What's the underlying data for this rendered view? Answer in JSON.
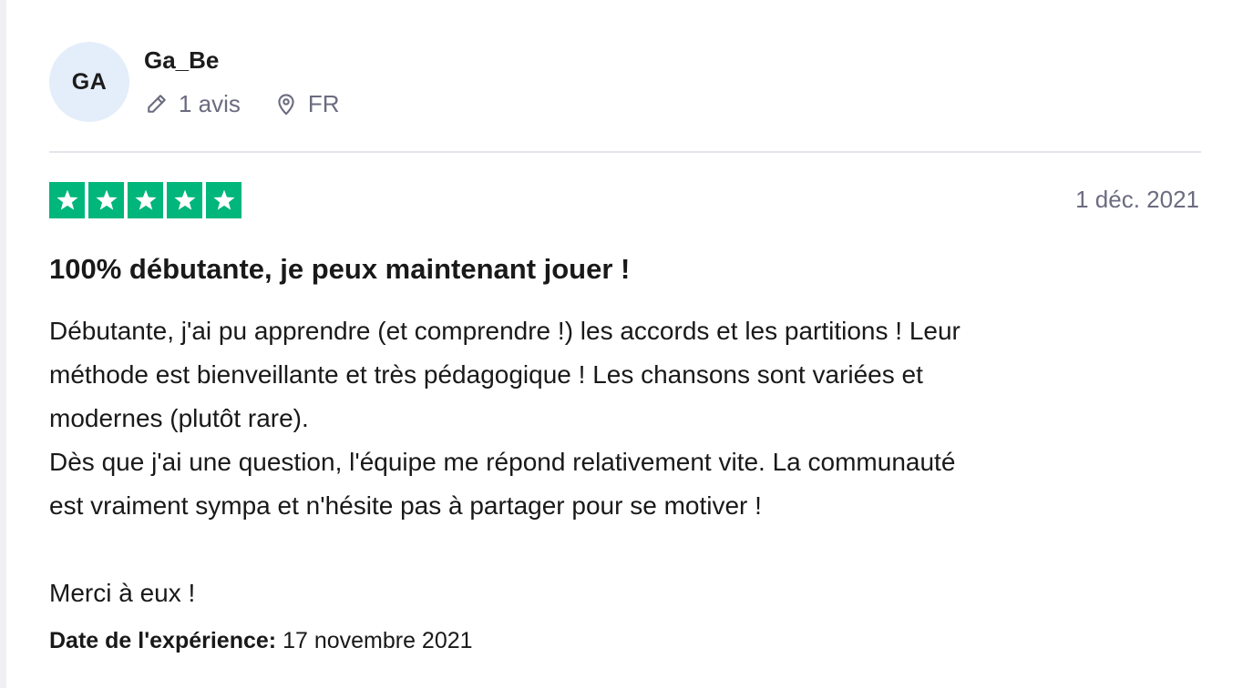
{
  "reviewer": {
    "initials": "GA",
    "name": "Ga_Be",
    "reviews_count": "1 avis",
    "country": "FR",
    "review_icon": "pencil-icon",
    "country_icon": "location-pin-icon"
  },
  "review": {
    "rating": 5,
    "rating_max": 5,
    "date": "1 déc. 2021",
    "title": "100% débutante, je peux maintenant jouer !",
    "body_lines": [
      "Débutante, j'ai pu apprendre (et comprendre !) les accords et les partitions ! Leur",
      "méthode est bienveillante et très pédagogique ! Les chansons sont variées et",
      "modernes (plutôt rare).",
      "Dès que j'ai une question, l'équipe me répond relativement vite. La communauté",
      "est vraiment sympa et n'hésite pas à partager pour se motiver !",
      "",
      "Merci à eux !"
    ],
    "experience_label": "Date de l'expérience:",
    "experience_date": "17 novembre 2021"
  },
  "colors": {
    "star_green": "#00b67a",
    "avatar_bg": "#e4eefa",
    "muted_text": "#6b6b80"
  }
}
